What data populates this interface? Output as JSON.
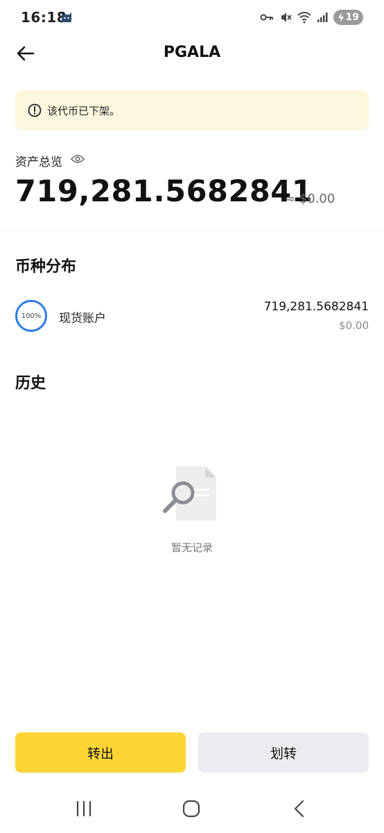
{
  "status_bar": {
    "time": "16:18",
    "battery": "19",
    "icons": [
      "cat-app-icon",
      "key-icon",
      "mute-icon",
      "wifi-icon",
      "signal-icon",
      "charging-icon"
    ]
  },
  "header": {
    "title": "PGALA",
    "back_icon": "arrow-left-icon"
  },
  "notice": {
    "icon": "info-circle-icon",
    "text": "该代币已下架。"
  },
  "overview": {
    "label": "资产总览",
    "eye_icon": "eye-icon",
    "amount": "719,281.5682841",
    "approx": "≈ $0.00"
  },
  "distribution": {
    "title": "币种分布",
    "rows": [
      {
        "percent": "100%",
        "percent_value": 100,
        "name": "现货账户",
        "amount": "719,281.5682841",
        "usd": "$0.00"
      }
    ]
  },
  "history": {
    "title": "历史",
    "empty_text": "暂无记录",
    "empty_icon": "search-document-icon"
  },
  "actions": {
    "primary_label": "转出",
    "secondary_label": "划转"
  },
  "colors": {
    "accent_yellow": "#fcd535",
    "secondary_gray": "#eaecef",
    "notice_bg": "#fdf7df",
    "ring_blue": "#2f7de1"
  },
  "nav": {
    "icons": [
      "recent-apps-icon",
      "home-icon",
      "back-icon"
    ]
  }
}
